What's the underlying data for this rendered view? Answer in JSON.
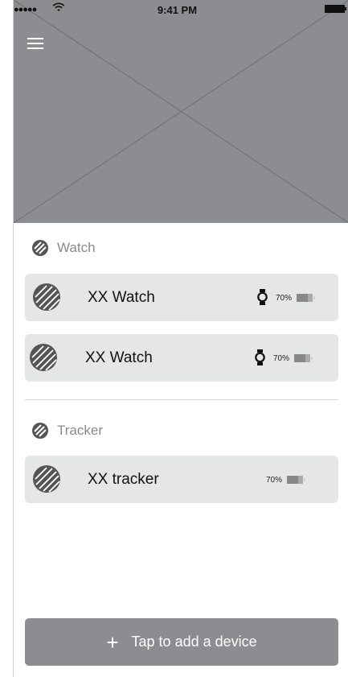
{
  "status_bar": {
    "signal": "●●●●●",
    "time": "9:41 PM"
  },
  "hero": {
    "placeholder": "image-placeholder"
  },
  "sections": {
    "watch": {
      "label": "Watch",
      "devices": [
        {
          "name": "XX Watch",
          "battery": "70%",
          "battery_level": 0.7
        },
        {
          "name": "XX Watch",
          "battery": "70%",
          "battery_level": 0.7
        }
      ]
    },
    "tracker": {
      "label": "Tracker",
      "devices": [
        {
          "name": "XX tracker",
          "battery": "70%",
          "battery_level": 0.7
        }
      ]
    }
  },
  "add_button": {
    "icon": "+",
    "label": "Tap to add a device"
  },
  "colors": {
    "hero_bg": "#8c8d90",
    "card_bg": "#e5e6e6",
    "button_bg": "#8c8d90",
    "section_text": "#8a8a8a"
  }
}
